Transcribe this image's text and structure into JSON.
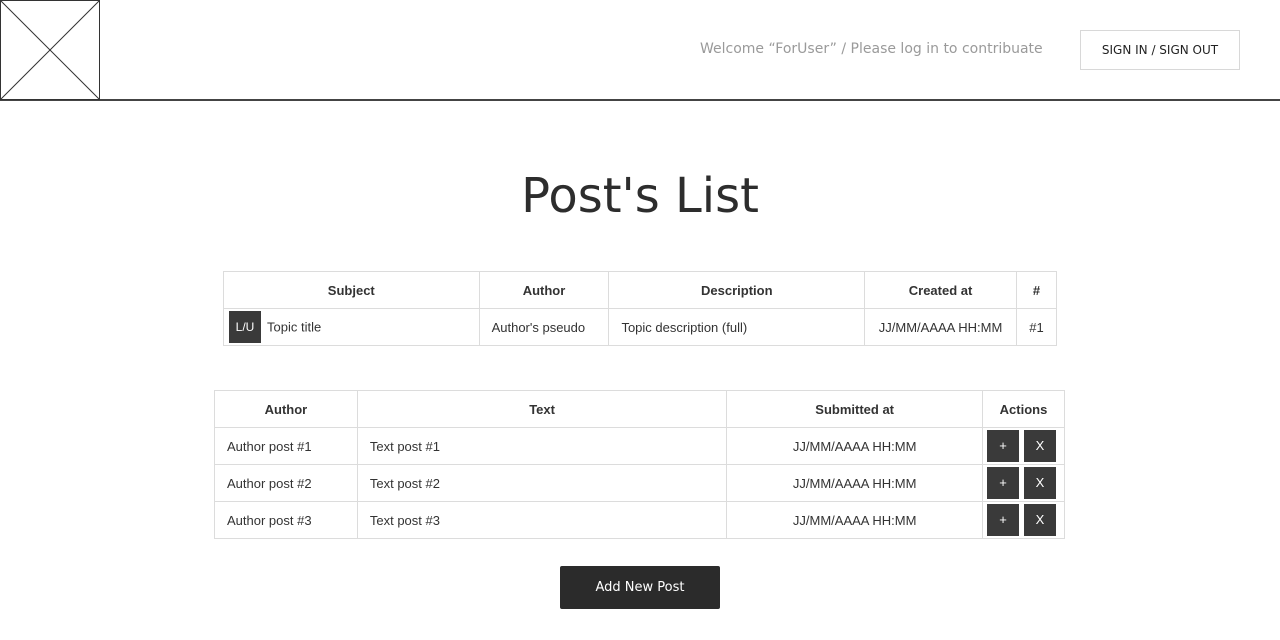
{
  "header": {
    "welcome_text": "Welcome “ForUser” / Please log in to contribuate",
    "signin_label": "SIGN IN / SIGN OUT"
  },
  "page": {
    "title": "Post's List"
  },
  "topic_table": {
    "headers": {
      "subject": "Subject",
      "author": "Author",
      "description": "Description",
      "created_at": "Created at",
      "number": "#"
    },
    "row": {
      "badge": "L/U",
      "subject": "Topic title",
      "author": "Author's pseudo",
      "description": "Topic description (full)",
      "created_at": "JJ/MM/AAAA HH:MM",
      "number": "#1"
    }
  },
  "posts_table": {
    "headers": {
      "author": "Author",
      "text": "Text",
      "submitted_at": "Submitted at",
      "actions": "Actions"
    },
    "add_label": "+",
    "delete_label": "X",
    "rows": [
      {
        "author": "Author post #1",
        "text": "Text post #1",
        "submitted_at": "JJ/MM/AAAA HH:MM"
      },
      {
        "author": "Author post #2",
        "text": "Text post #2",
        "submitted_at": "JJ/MM/AAAA HH:MM"
      },
      {
        "author": "Author post #3",
        "text": "Text post #3",
        "submitted_at": "JJ/MM/AAAA HH:MM"
      }
    ]
  },
  "footer": {
    "add_post_label": "Add New Post"
  },
  "icons": {
    "logo": "logo-placeholder-icon"
  },
  "colors": {
    "dark_button": "#3a3a3a",
    "add_button": "#2b2b2b",
    "welcome_text": "#9a9a9a",
    "border": "#dcdcdc"
  }
}
